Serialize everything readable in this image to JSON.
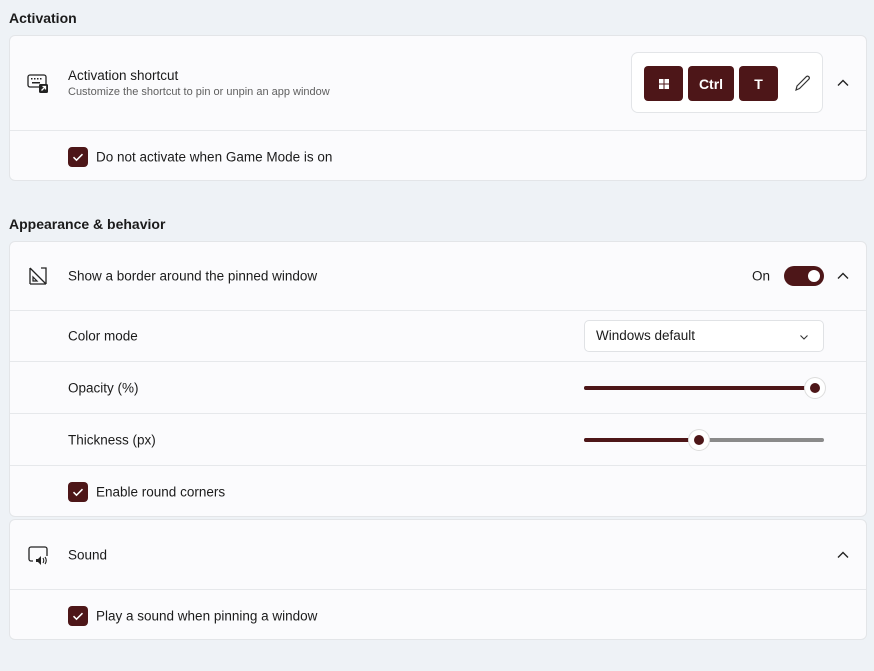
{
  "accent_color": "#4d1618",
  "activation": {
    "section_title": "Activation",
    "shortcut_title": "Activation shortcut",
    "shortcut_desc": "Customize the shortcut to pin or unpin an app window",
    "keys": [
      "win-logo-icon",
      "Ctrl",
      "T"
    ],
    "game_mode_label": "Do not activate when Game Mode is on",
    "game_mode_checked": true
  },
  "appearance": {
    "section_title": "Appearance & behavior",
    "border_title": "Show a border around the pinned window",
    "border_state": "On",
    "border_on": true,
    "color_mode_label": "Color mode",
    "color_mode_value": "Windows default",
    "opacity_label": "Opacity (%)",
    "opacity_value": 100,
    "thickness_label": "Thickness (px)",
    "thickness_fill_fraction": 0.48,
    "round_corners_label": "Enable round corners",
    "round_corners_checked": true
  },
  "sound": {
    "title": "Sound",
    "play_label": "Play a sound when pinning a window",
    "play_checked": true
  }
}
